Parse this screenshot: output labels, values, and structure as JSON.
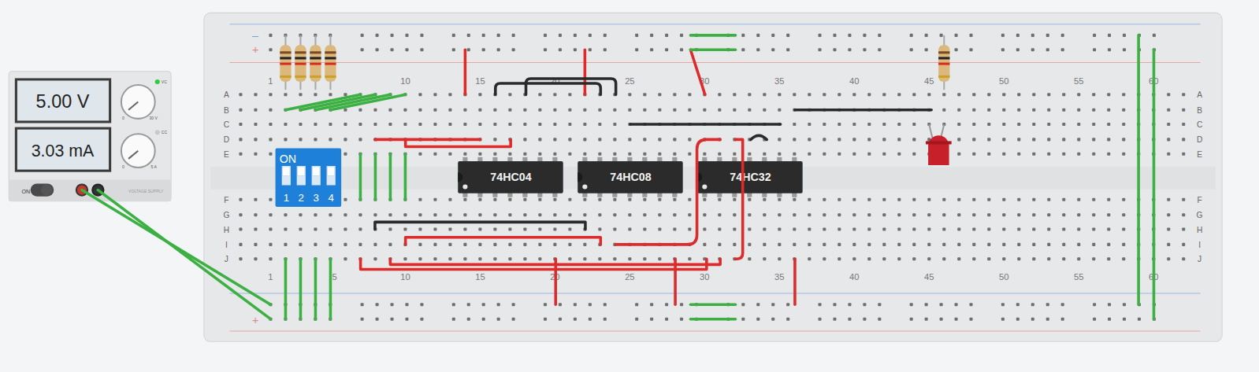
{
  "power_supply": {
    "voltage": "5.00 V",
    "current": "3.03 mA",
    "voltage_knob_min": "0",
    "voltage_knob_max": "30 V",
    "current_knob_min": "0",
    "current_knob_max": "5 A",
    "cv_label": "VC",
    "cc_label": "CC",
    "cv_active": true,
    "cc_active": false,
    "switch_label": "ON",
    "switch_on": true,
    "brand": "VOLTAGE SUPPLY"
  },
  "breadboard": {
    "row_letters_top": [
      "A",
      "B",
      "C",
      "D",
      "E"
    ],
    "row_letters_bottom": [
      "F",
      "G",
      "H",
      "I",
      "J"
    ],
    "column_numbers_top": [
      "1",
      "10",
      "15",
      "20",
      "25",
      "30",
      "35",
      "40",
      "45",
      "50",
      "55",
      "60"
    ],
    "column_numbers_bottom": [
      "1",
      "5",
      "10",
      "15",
      "20",
      "25",
      "30",
      "35",
      "40",
      "45",
      "50",
      "55",
      "60"
    ],
    "top_rail": {
      "minus": "–",
      "plus": "+"
    },
    "bottom_rail": {
      "plus": "+"
    }
  },
  "dip_switch": {
    "label": "ON",
    "switches": [
      {
        "label": "1",
        "on": true
      },
      {
        "label": "2",
        "on": true
      },
      {
        "label": "3",
        "on": true
      },
      {
        "label": "4",
        "on": true
      }
    ]
  },
  "chips": [
    {
      "label": "74HC04"
    },
    {
      "label": "74HC08"
    },
    {
      "label": "74HC32"
    }
  ],
  "led": {
    "lit": false
  }
}
